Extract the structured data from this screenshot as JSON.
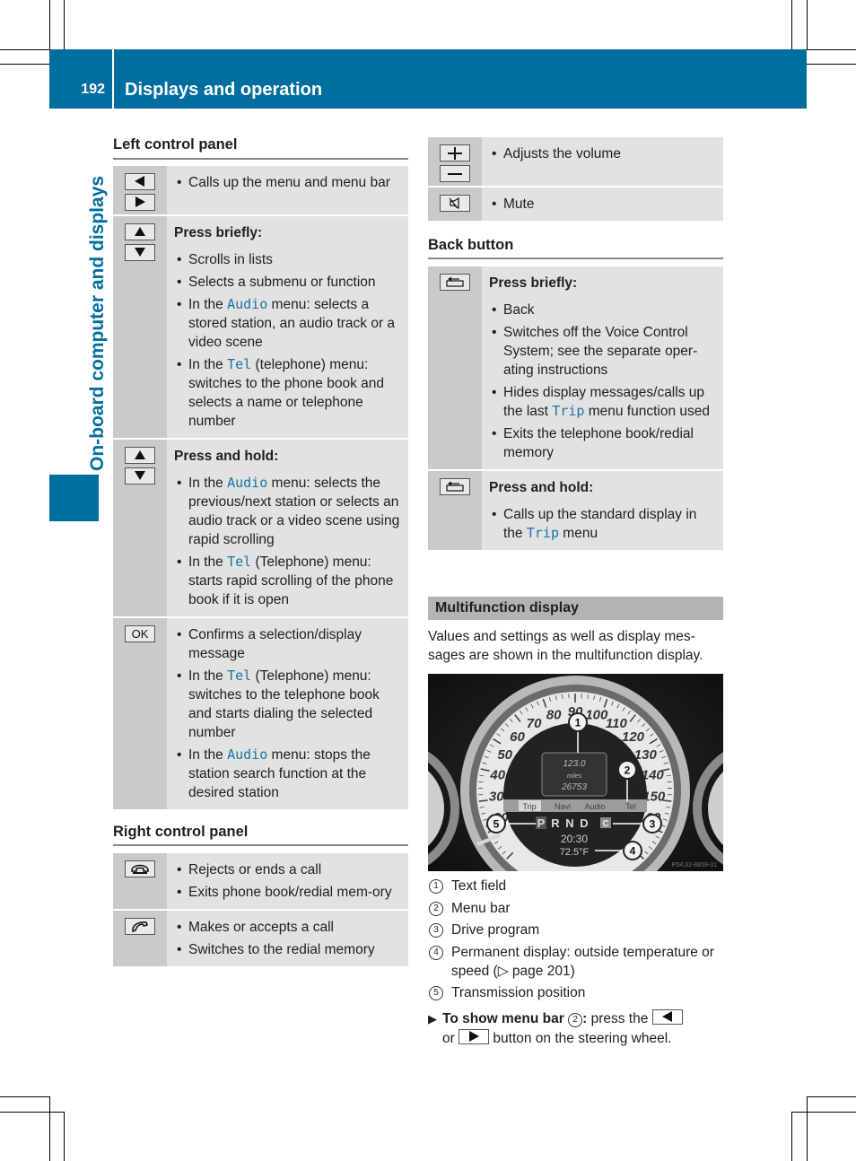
{
  "header": {
    "page_number": "192",
    "title": "Displays and operation",
    "color": "#016ea0"
  },
  "side_tab": {
    "label": "On-board computer and displays"
  },
  "left_control_panel": {
    "title": "Left control panel",
    "rows": [
      {
        "keys": [
          "left-arrow-icon",
          "right-arrow-icon"
        ],
        "bullets": [
          {
            "parts": [
              {
                "t": "Calls up the menu and menu bar"
              }
            ]
          }
        ]
      },
      {
        "keys": [
          "up-arrow-icon",
          "down-arrow-icon"
        ],
        "heading": "Press briefly:",
        "bullets": [
          {
            "parts": [
              {
                "t": "Scrolls in lists"
              }
            ]
          },
          {
            "parts": [
              {
                "t": "Selects a submenu or function"
              }
            ]
          },
          {
            "parts": [
              {
                "t": "In the "
              },
              {
                "m": "Audio"
              },
              {
                "t": " menu: selects a stored station, an audio track or a video scene"
              }
            ]
          },
          {
            "parts": [
              {
                "t": "In the "
              },
              {
                "m": "Tel"
              },
              {
                "t": " (telephone) menu: switches to the phone book and selects a name or telephone number"
              }
            ]
          }
        ]
      },
      {
        "keys": [
          "up-arrow-icon",
          "down-arrow-icon"
        ],
        "heading": "Press and hold:",
        "bullets": [
          {
            "parts": [
              {
                "t": "In the "
              },
              {
                "m": "Audio"
              },
              {
                "t": " menu: selects the previous/next station or selects an audio track or a video scene using rapid scrolling"
              }
            ]
          },
          {
            "parts": [
              {
                "t": "In the "
              },
              {
                "m": "Tel"
              },
              {
                "t": " (Telephone) menu: starts rapid scrolling of the phone book if it is open"
              }
            ]
          }
        ]
      },
      {
        "keys": [
          "ok-button-key"
        ],
        "key_label": "OK",
        "bullets": [
          {
            "parts": [
              {
                "t": "Confirms a selection/display message"
              }
            ]
          },
          {
            "parts": [
              {
                "t": "In the "
              },
              {
                "m": "Tel"
              },
              {
                "t": " (Telephone) menu: switches to the telephone book and starts dialing the selected number"
              }
            ]
          },
          {
            "parts": [
              {
                "t": "In the "
              },
              {
                "m": "Audio"
              },
              {
                "t": " menu: stops the station search function at the desired station"
              }
            ]
          }
        ]
      }
    ]
  },
  "right_control_panel": {
    "title": "Right control panel",
    "rows": [
      {
        "keys": [
          "end-call-icon"
        ],
        "bullets": [
          {
            "parts": [
              {
                "t": "Rejects or ends a call"
              }
            ]
          },
          {
            "parts": [
              {
                "t": "Exits phone book/redial mem-ory"
              }
            ]
          }
        ]
      },
      {
        "keys": [
          "accept-call-icon"
        ],
        "bullets": [
          {
            "parts": [
              {
                "t": "Makes or accepts a call"
              }
            ]
          },
          {
            "parts": [
              {
                "t": "Switches to the redial memory"
              }
            ]
          }
        ]
      }
    ]
  },
  "volume_panel": {
    "rows": [
      {
        "keys": [
          "plus-icon",
          "minus-icon"
        ],
        "bullets": [
          {
            "parts": [
              {
                "t": "Adjusts the volume"
              }
            ]
          }
        ]
      },
      {
        "keys": [
          "mute-icon"
        ],
        "bullets": [
          {
            "parts": [
              {
                "t": "Mute"
              }
            ]
          }
        ]
      }
    ]
  },
  "back_button": {
    "title": "Back button",
    "rows": [
      {
        "keys": [
          "back-icon"
        ],
        "heading": "Press briefly:",
        "bullets": [
          {
            "parts": [
              {
                "t": "Back"
              }
            ]
          },
          {
            "parts": [
              {
                "t": "Switches off the Voice Control System; see the separate oper-ating instructions"
              }
            ]
          },
          {
            "parts": [
              {
                "t": "Hides display messages/calls up the last "
              },
              {
                "m": "Trip"
              },
              {
                "t": " menu function used"
              }
            ]
          },
          {
            "parts": [
              {
                "t": "Exits the telephone book/redial memory"
              }
            ]
          }
        ]
      },
      {
        "keys": [
          "back-icon"
        ],
        "heading": "Press and hold:",
        "bullets": [
          {
            "parts": [
              {
                "t": "Calls up the standard display in the "
              },
              {
                "m": "Trip"
              },
              {
                "t": " menu"
              }
            ]
          }
        ]
      }
    ]
  },
  "multifunction_display": {
    "title": "Multifunction display",
    "paragraph": "Values and settings as well as display mes-sages are shown in the multifunction display.",
    "image": {
      "speed_labels": [
        "20",
        "30",
        "40",
        "50",
        "60",
        "70",
        "80",
        "90",
        "100",
        "110",
        "120",
        "130",
        "140",
        "150",
        "160"
      ],
      "text_field": [
        "123.0",
        "miles",
        "26753"
      ],
      "menu_bar": [
        "Trip",
        "Navi",
        "Audio",
        "Tel"
      ],
      "gears": [
        "P",
        "R",
        "N",
        "D"
      ],
      "drive_program": "C",
      "time": "20:30",
      "temperature": "72.5°F",
      "callouts": [
        "1",
        "2",
        "3",
        "4",
        "5"
      ],
      "image_code": "P54.32-8859-31"
    },
    "legend": [
      {
        "num": "1",
        "text": "Text field"
      },
      {
        "num": "2",
        "text": "Menu bar"
      },
      {
        "num": "3",
        "text": "Drive program"
      },
      {
        "num": "4",
        "text": "Permanent display: outside temperature or speed (▷ page 201)"
      },
      {
        "num": "5",
        "text": "Transmission position"
      }
    ],
    "instruction": {
      "bold": "To show menu bar",
      "ref": "2",
      "colon": ":",
      "text1": " press the ",
      "text2": "or ",
      "text3": " button on the steering wheel."
    }
  }
}
